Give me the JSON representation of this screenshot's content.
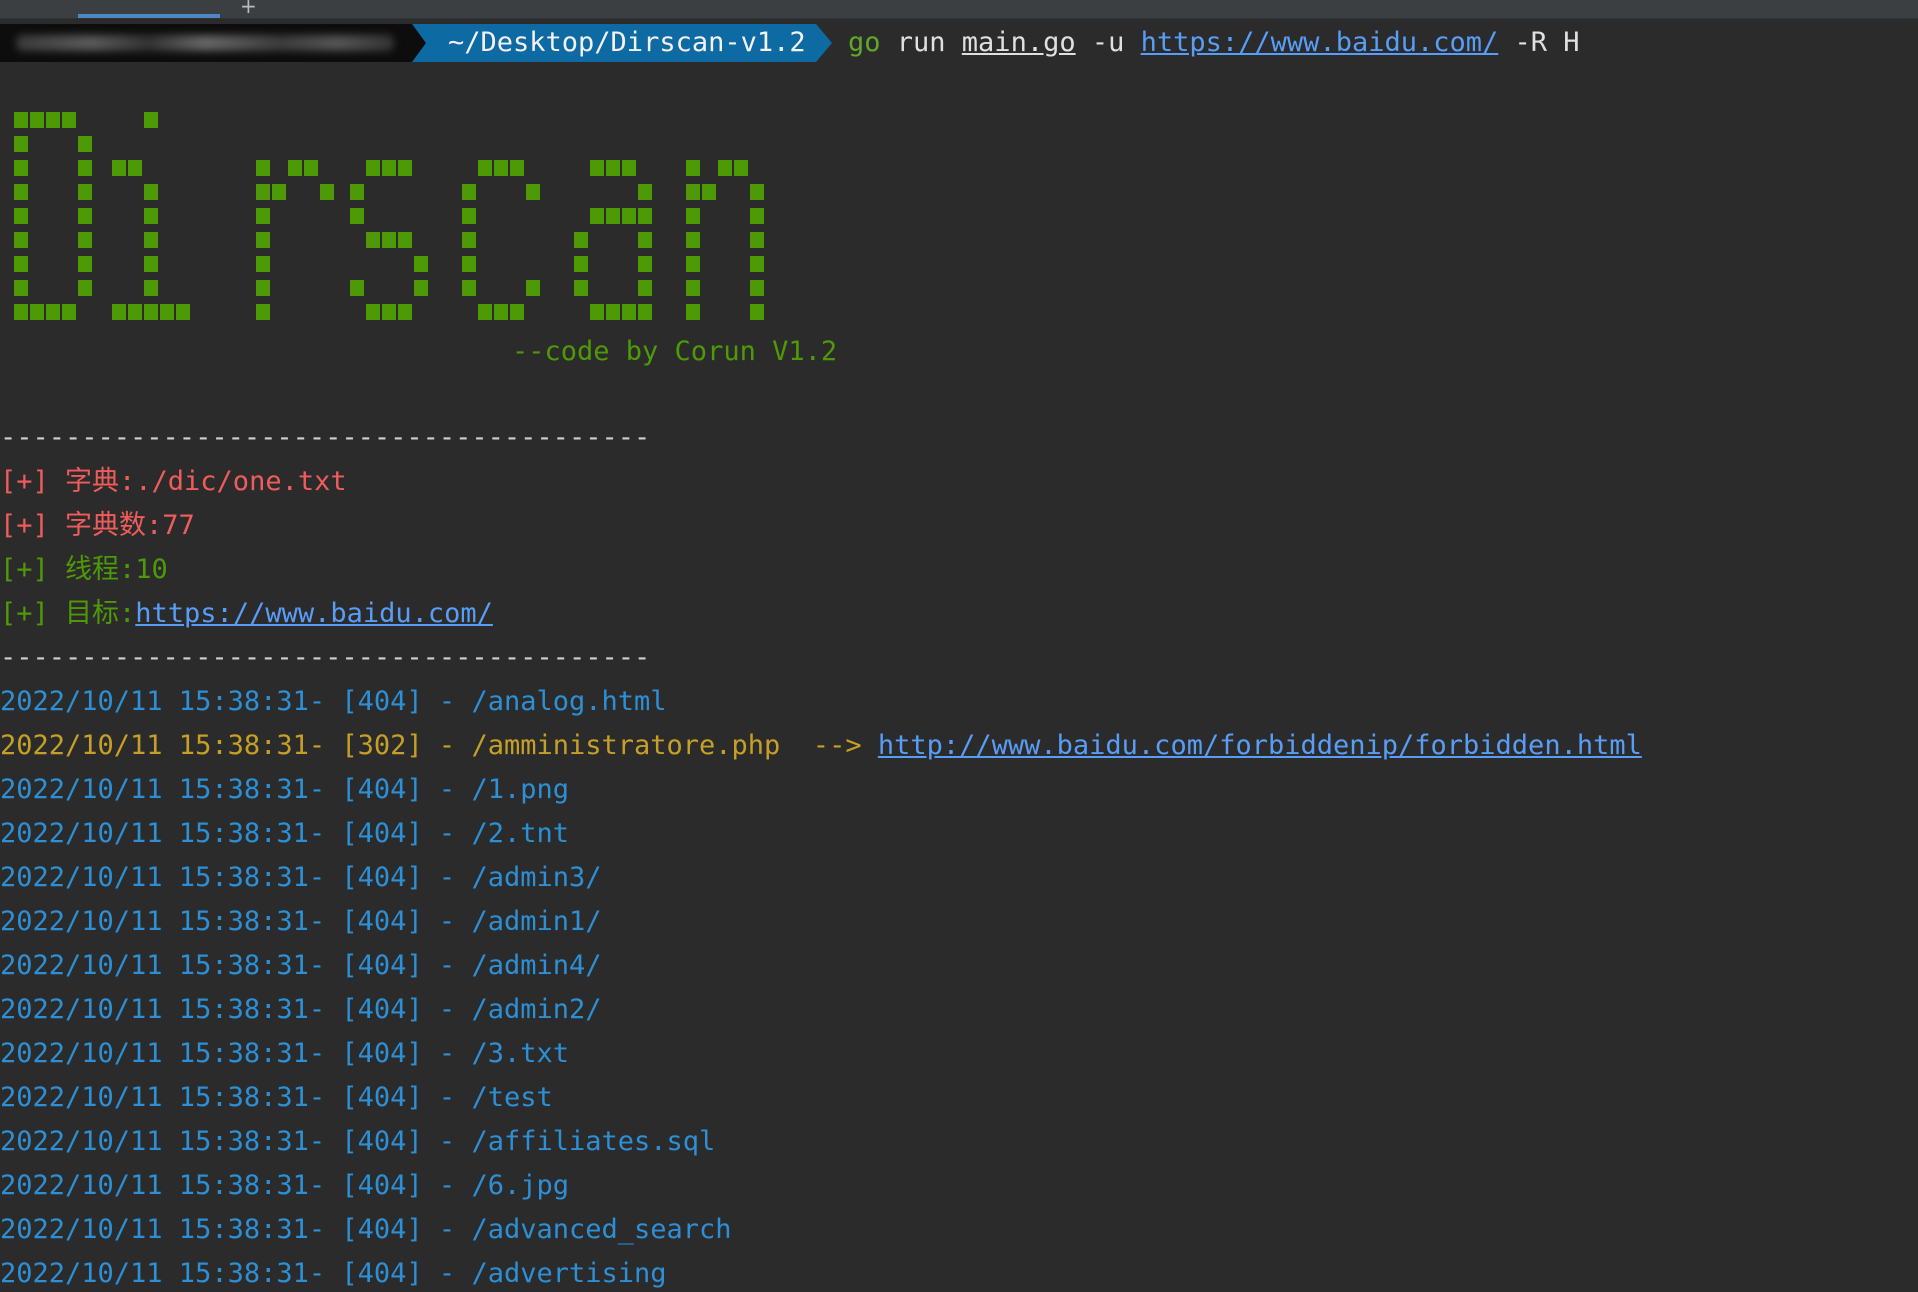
{
  "tabs": [
    {
      "label": ""
    },
    {
      "label": ""
    }
  ],
  "tab_add_label": "+",
  "prompt": {
    "path": "~/Desktop/Dirscan-v1.2",
    "cmd_go": "go",
    "cmd_run": " run ",
    "cmd_file": "main.go",
    "cmd_flag": " -u ",
    "cmd_url": "https://www.baidu.com/",
    "cmd_tail": " -R H"
  },
  "banner": {
    "text": "Dirscan",
    "credit": "--code by Corun V1.2",
    "color": "#4e9a06"
  },
  "separator": "----------------------------------------",
  "info": [
    {
      "text": "[+] 字典:./dic/one.txt",
      "link": "",
      "color": "red"
    },
    {
      "text": "[+] 字典数:77",
      "link": "",
      "color": "red"
    },
    {
      "text": "[+] 线程:10",
      "link": "",
      "color": "green"
    },
    {
      "text": "[+] 目标:",
      "link": "https://www.baidu.com/",
      "color": "green"
    }
  ],
  "results": [
    {
      "time": "2022/10/11 15:38:31-",
      "status": "[404]",
      "path": "/analog.html",
      "redirect": ""
    },
    {
      "time": "2022/10/11 15:38:31-",
      "status": "[302]",
      "path": "/amministratore.php",
      "redirect": "http://www.baidu.com/forbiddenip/forbidden.html"
    },
    {
      "time": "2022/10/11 15:38:31-",
      "status": "[404]",
      "path": "/1.png",
      "redirect": ""
    },
    {
      "time": "2022/10/11 15:38:31-",
      "status": "[404]",
      "path": "/2.tnt",
      "redirect": ""
    },
    {
      "time": "2022/10/11 15:38:31-",
      "status": "[404]",
      "path": "/admin3/",
      "redirect": ""
    },
    {
      "time": "2022/10/11 15:38:31-",
      "status": "[404]",
      "path": "/admin1/",
      "redirect": ""
    },
    {
      "time": "2022/10/11 15:38:31-",
      "status": "[404]",
      "path": "/admin4/",
      "redirect": ""
    },
    {
      "time": "2022/10/11 15:38:31-",
      "status": "[404]",
      "path": "/admin2/",
      "redirect": ""
    },
    {
      "time": "2022/10/11 15:38:31-",
      "status": "[404]",
      "path": "/3.txt",
      "redirect": ""
    },
    {
      "time": "2022/10/11 15:38:31-",
      "status": "[404]",
      "path": "/test",
      "redirect": ""
    },
    {
      "time": "2022/10/11 15:38:31-",
      "status": "[404]",
      "path": "/affiliates.sql",
      "redirect": ""
    },
    {
      "time": "2022/10/11 15:38:31-",
      "status": "[404]",
      "path": "/6.jpg",
      "redirect": ""
    },
    {
      "time": "2022/10/11 15:38:31-",
      "status": "[404]",
      "path": "/advanced_search",
      "redirect": ""
    },
    {
      "time": "2022/10/11 15:38:31-",
      "status": "[404]",
      "path": "/advertising",
      "redirect": ""
    }
  ],
  "redirect_arrow": "  --> ",
  "colors": {
    "background": "#2b2b2b",
    "status_404": "#2d8fd5",
    "status_302": "#c6a026",
    "info_red": "#f05c5c",
    "info_green": "#4e9a06",
    "link": "#589df6",
    "path_segment": "#0e6aa3"
  }
}
